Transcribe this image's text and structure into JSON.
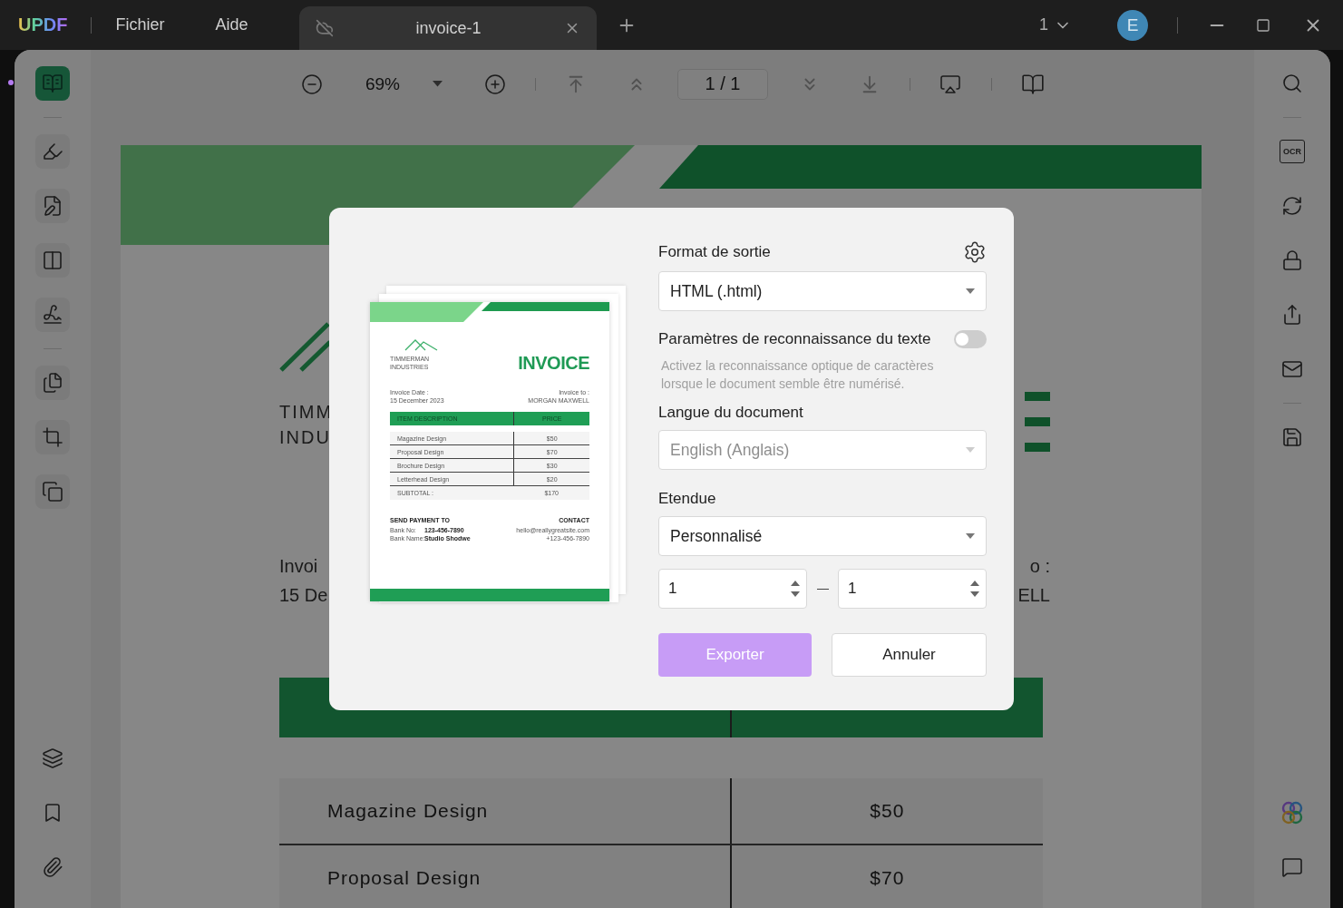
{
  "app": {
    "logo": "UPDF",
    "menus": [
      "Fichier",
      "Aide"
    ]
  },
  "tabs": [
    {
      "title": "invoice-1",
      "selected": true
    }
  ],
  "window_controls": {
    "window_count": "1",
    "avatar": "E"
  },
  "left_sidebar": {
    "groups": [
      {
        "items": [
          {
            "kind": "reader",
            "selected": true
          }
        ]
      },
      {
        "items": [
          {
            "kind": "comment",
            "selected": false
          },
          {
            "kind": "edit",
            "selected": false
          },
          {
            "kind": "form",
            "selected": false
          },
          {
            "kind": "sign",
            "selected": false
          }
        ]
      },
      {
        "items": [
          {
            "kind": "organize",
            "selected": false
          },
          {
            "kind": "crop",
            "selected": false
          },
          {
            "kind": "watermark",
            "selected": false
          }
        ]
      }
    ],
    "bottom": [
      {
        "kind": "layers"
      },
      {
        "kind": "bookmark"
      },
      {
        "kind": "attachment"
      }
    ]
  },
  "toolbar": {
    "zoom": "69%",
    "page": "1 / 1"
  },
  "right_sidebar": {
    "groups": [
      {
        "items": [
          {
            "kind": "search"
          }
        ]
      },
      {
        "items": [
          {
            "kind": "ocr",
            "label": "OCR"
          },
          {
            "kind": "convert"
          },
          {
            "kind": "protect"
          },
          {
            "kind": "share"
          },
          {
            "kind": "email"
          }
        ]
      },
      {
        "items": [
          {
            "kind": "save"
          }
        ]
      }
    ],
    "bottom": [
      {
        "kind": "ai"
      },
      {
        "kind": "comments"
      }
    ]
  },
  "document": {
    "company": [
      "TIMM",
      "INDU"
    ],
    "date_label": "Invoi",
    "date": "15 De",
    "to_label": "o :",
    "to_name": "ELL",
    "rows": [
      {
        "item": "Magazine Design",
        "price": "$50"
      },
      {
        "item": "Proposal Design",
        "price": "$70"
      }
    ]
  },
  "dialog": {
    "preview": {
      "company": [
        "TIMMERMAN",
        "INDUSTRIES"
      ],
      "title": "INVOICE",
      "date_label": "Invoice Date :",
      "date": "15 December 2023",
      "to_label": "Invoice to :",
      "to_name": "MORGAN MAXWELL",
      "columns": [
        "ITEM DESCRIPTION",
        "PRICE"
      ],
      "rows": [
        {
          "item": "Magazine Design",
          "price": "$50"
        },
        {
          "item": "Proposal Design",
          "price": "$70"
        },
        {
          "item": "Brochure Design",
          "price": "$30"
        },
        {
          "item": "Letterhead Design",
          "price": "$20"
        }
      ],
      "subtotal_label": "SUBTOTAL :",
      "subtotal": "$170",
      "payment_heading": "SEND PAYMENT TO",
      "bank_no_label": "Bank No:",
      "bank_no": "123-456-7890",
      "bank_name_label": "Bank Name:",
      "bank_name": "Studio Shodwe",
      "contact_heading": "CONTACT",
      "email": "hello@reallygreatsite.com",
      "phone": "+123-456-7890"
    },
    "output_format": {
      "label": "Format de sortie",
      "value": "HTML (.html)",
      "disabled": false
    },
    "ocr": {
      "label": "Paramètres de reconnaissance du texte",
      "on": false,
      "hint": "Activez la reconnaissance optique de caractères lorsque le document semble être numérisé."
    },
    "language": {
      "label": "Langue du document",
      "value": "English (Anglais)",
      "disabled": true
    },
    "range": {
      "label": "Etendue",
      "value": "Personnalisé",
      "disabled": false,
      "from": "1",
      "to": "1"
    },
    "buttons": [
      {
        "kind": "primary",
        "label": "Exporter"
      },
      {
        "kind": "secondary",
        "label": "Annuler"
      }
    ]
  }
}
